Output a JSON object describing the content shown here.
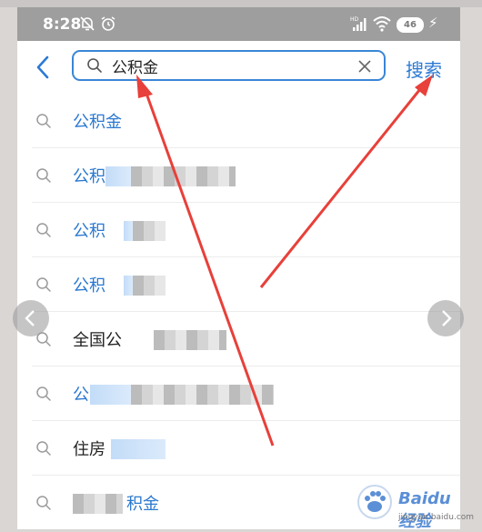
{
  "status_bar": {
    "time": "8:28",
    "battery": "46"
  },
  "header": {
    "search_value": "公积金",
    "search_button": "搜索"
  },
  "suggestions": [
    {
      "text": "公积金"
    },
    {
      "text": "公积"
    },
    {
      "text": "公积"
    },
    {
      "text": "公积"
    },
    {
      "text": "全国公"
    },
    {
      "text": "公"
    },
    {
      "text": "住房"
    },
    {
      "text": "积金"
    }
  ],
  "watermark": {
    "brand": "Baidu经验",
    "url": "jingyan.baidu.com"
  },
  "colors": {
    "accent": "#2a78d0",
    "status_bar": "#9e9e9e",
    "arrow": "#e8403a"
  }
}
